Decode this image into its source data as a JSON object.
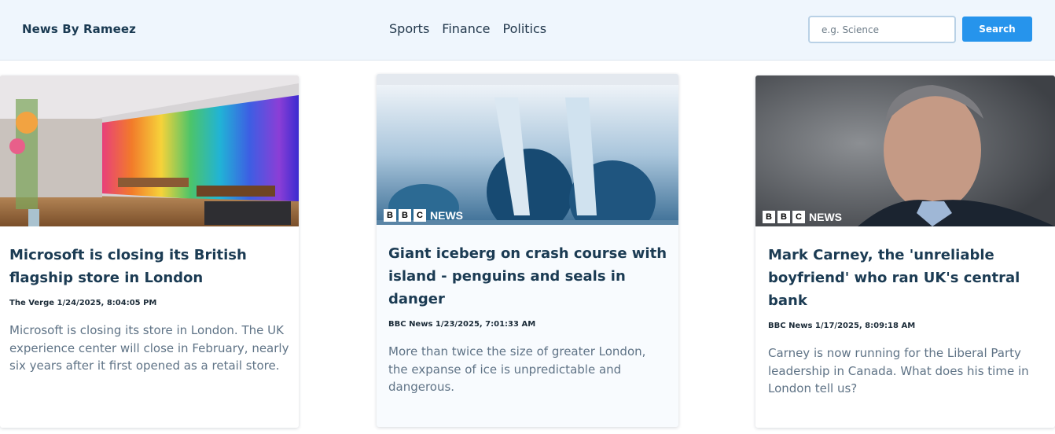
{
  "navbar": {
    "brand": "News By Rameez",
    "links": [
      {
        "label": "Sports"
      },
      {
        "label": "Finance"
      },
      {
        "label": "Politics"
      }
    ],
    "search": {
      "placeholder": "e.g. Science",
      "value": "",
      "button_label": "Search"
    }
  },
  "articles": [
    {
      "title": "Microsoft is closing its British flagship store in London",
      "source": "The Verge",
      "date": "1/24/2025, 8:04:05 PM",
      "meta": "The Verge 1/24/2025, 8:04:05 PM",
      "description": "Microsoft is closing its store in London. The UK experience center will close in February, nearly six years after it first opened as a retail store.",
      "image": "microsoft-store-photo",
      "overlay": ""
    },
    {
      "title": "Giant iceberg on crash course with island - penguins and seals in danger",
      "source": "BBC News",
      "date": "1/23/2025, 7:01:33 AM",
      "meta": "BBC News 1/23/2025, 7:01:33 AM",
      "description": "More than twice the size of greater London, the expanse of ice is unpredictable and dangerous.",
      "image": "iceberg-photo",
      "overlay": "BBC NEWS"
    },
    {
      "title": "Mark Carney, the 'unreliable boyfriend' who ran UK's central bank",
      "source": "BBC News",
      "date": "1/17/2025, 8:09:18 AM",
      "meta": "BBC News 1/17/2025, 8:09:18 AM",
      "description": "Carney is now running for the Liberal Party leadership in Canada. What does his time in London tell us?",
      "image": "mark-carney-portrait",
      "overlay": "BBC NEWS"
    }
  ],
  "colors": {
    "navbar_bg": "#eff6fd",
    "brand_text": "#1a3a52",
    "search_button": "#2694ec",
    "title_text": "#1b3b53",
    "description_text": "#5f7386"
  }
}
